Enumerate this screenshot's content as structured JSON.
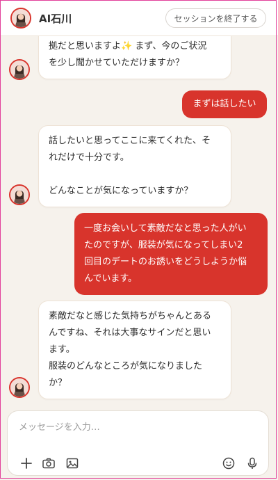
{
  "header": {
    "title": "AI石川",
    "end_session_label": "セッションを終了する"
  },
  "messages": [
    {
      "role": "ai",
      "text": "拠だと思いますよ✨ まず、今のご状況\nを少し聞かせていただけますか？"
    },
    {
      "role": "user",
      "text": "まずは話したい"
    },
    {
      "role": "ai",
      "text": "話したいと思ってここに来てくれた、そ\nれだけで十分です。\n\nどんなことが気になっていますか？"
    },
    {
      "role": "user",
      "text": "一度お会いして素敵だなと思った人がい\nたのですが、服装が気になってしまい2\n回目のデートのお誘いをどうしようか悩\nんでいます。"
    },
    {
      "role": "ai",
      "text": "素敵だなと感じた気持ちがちゃんとある\nんですね、それは大事なサインだと思い\nます。\n服装のどんなところが気になりました\nか？"
    }
  ],
  "composer": {
    "placeholder": "メッセージを入力…",
    "tools": [
      "plus-icon",
      "camera-icon",
      "image-icon",
      "emoji-icon",
      "microphone-icon"
    ]
  },
  "colors": {
    "accent": "#d8342c",
    "background": "#f6f2ec",
    "ai_bubble": "#ffffff",
    "frame": "#e23f9a"
  }
}
